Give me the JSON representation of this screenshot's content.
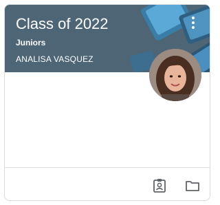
{
  "card": {
    "title": "Class of 2022",
    "section": "Juniors",
    "teacher": "ANALISA VASQUEZ"
  },
  "icons": {
    "more": "more-vertical-icon",
    "work": "assignment-ind-icon",
    "folder": "folder-icon"
  },
  "colors": {
    "header_bg": "#4e6575",
    "header_text": "#ffffff",
    "icon": "#5f6368",
    "border": "#dadce0"
  }
}
